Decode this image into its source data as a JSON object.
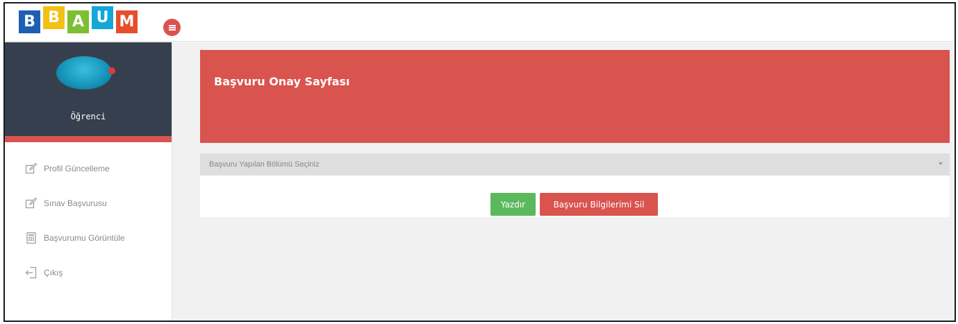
{
  "header": {
    "logo_letters": [
      "B",
      "B",
      "A",
      "U",
      "M"
    ],
    "menu_icon": "hamburger-icon"
  },
  "sidebar": {
    "role": "Öğrenci",
    "items": [
      {
        "label": "Profil Güncelleme",
        "icon": "edit-icon"
      },
      {
        "label": "Sınav Başvurusu",
        "icon": "edit-icon"
      },
      {
        "label": "Başvurumu Görüntüle",
        "icon": "calculator-icon"
      },
      {
        "label": "Çıkış",
        "icon": "logout-icon"
      }
    ]
  },
  "main": {
    "title": "Başvuru Onay Sayfası",
    "select_placeholder": "Başvuru Yapılan Bölümü Seçiniz",
    "print_label": "Yazdır",
    "delete_label": "Başvuru Bilgilerimi Sil"
  },
  "colors": {
    "accent_red": "#d9534f",
    "success_green": "#5cb85c",
    "sidebar_dark": "#363f4d"
  }
}
